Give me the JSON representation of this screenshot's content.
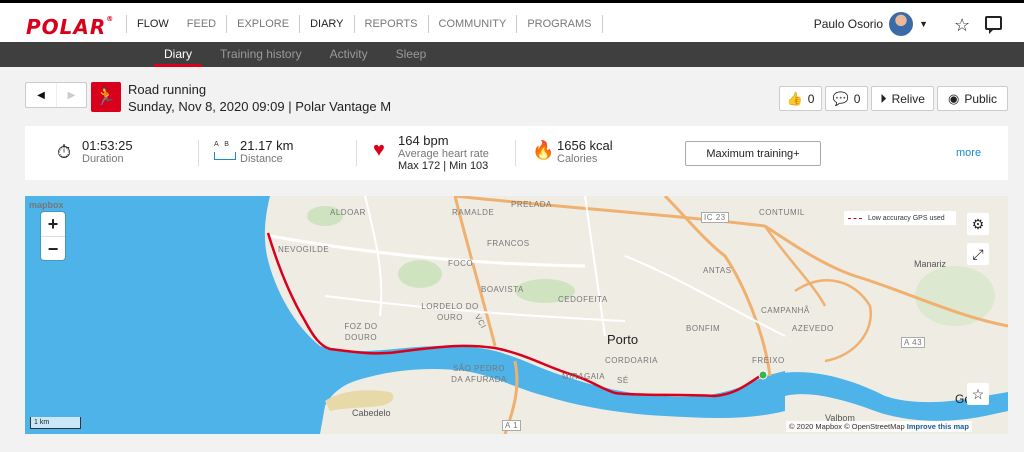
{
  "brand": {
    "logo": "POLAR",
    "reg": "®"
  },
  "nav": {
    "items": [
      "FLOW",
      "FEED",
      "EXPLORE",
      "DIARY",
      "REPORTS",
      "COMMUNITY",
      "PROGRAMS"
    ],
    "active": "DIARY"
  },
  "user": {
    "name": "Paulo Osorio"
  },
  "subnav": {
    "items": [
      "Diary",
      "Training history",
      "Activity",
      "Sleep"
    ],
    "active": "Diary"
  },
  "session": {
    "title": "Road running",
    "subtitle": "Sunday, Nov 8, 2020 09:09 | Polar Vantage M",
    "likes": "0",
    "comments": "0",
    "relive_label": "Relive",
    "public_label": "Public"
  },
  "stats": {
    "duration": {
      "value": "01:53:25",
      "label": "Duration"
    },
    "distance": {
      "value": "21.17 km",
      "label": "Distance",
      "icon_letters": "A B"
    },
    "heart_rate": {
      "value": "164 bpm",
      "label": "Average heart rate",
      "max_min": "Max 172  |  Min 103"
    },
    "calories": {
      "value": "1656 kcal",
      "label": "Calories"
    },
    "training_benefit": "Maximum training+",
    "more": "more"
  },
  "map": {
    "labels": [
      "ALDOAR",
      "RAMALDE",
      "PRELADA",
      "CONTUMIL",
      "NEVOGILDE",
      "FRANCOS",
      "FOCO",
      "ANTAS",
      "BOAVISTA",
      "CEDOFEITA",
      "LORDELO DO OURO",
      "FOZ DO DOURO",
      "BONFIM",
      "CAMPANHÃ",
      "AZEVEDO",
      "CORDOARIA",
      "MIRAGAIA",
      "SÃO PEDRO DA AFURADA",
      "SÉ",
      "FREIXO",
      "Porto",
      "Manariz",
      "Cabedelo",
      "Valbom",
      "Go",
      "VCI",
      "IC 23",
      "A 1",
      "A 43"
    ],
    "gps_legend": "Low accuracy GPS used",
    "scale": "1 km",
    "attribution": "© 2020 Mapbox © OpenStreetMap",
    "improve": "Improve this map",
    "mapbox_logo": "mapbox",
    "zoom_in": "+",
    "zoom_out": "−",
    "colors": {
      "route": "#d9001b",
      "water": "#4eb3e8",
      "land": "#efece4",
      "highway": "#f0b070"
    }
  }
}
